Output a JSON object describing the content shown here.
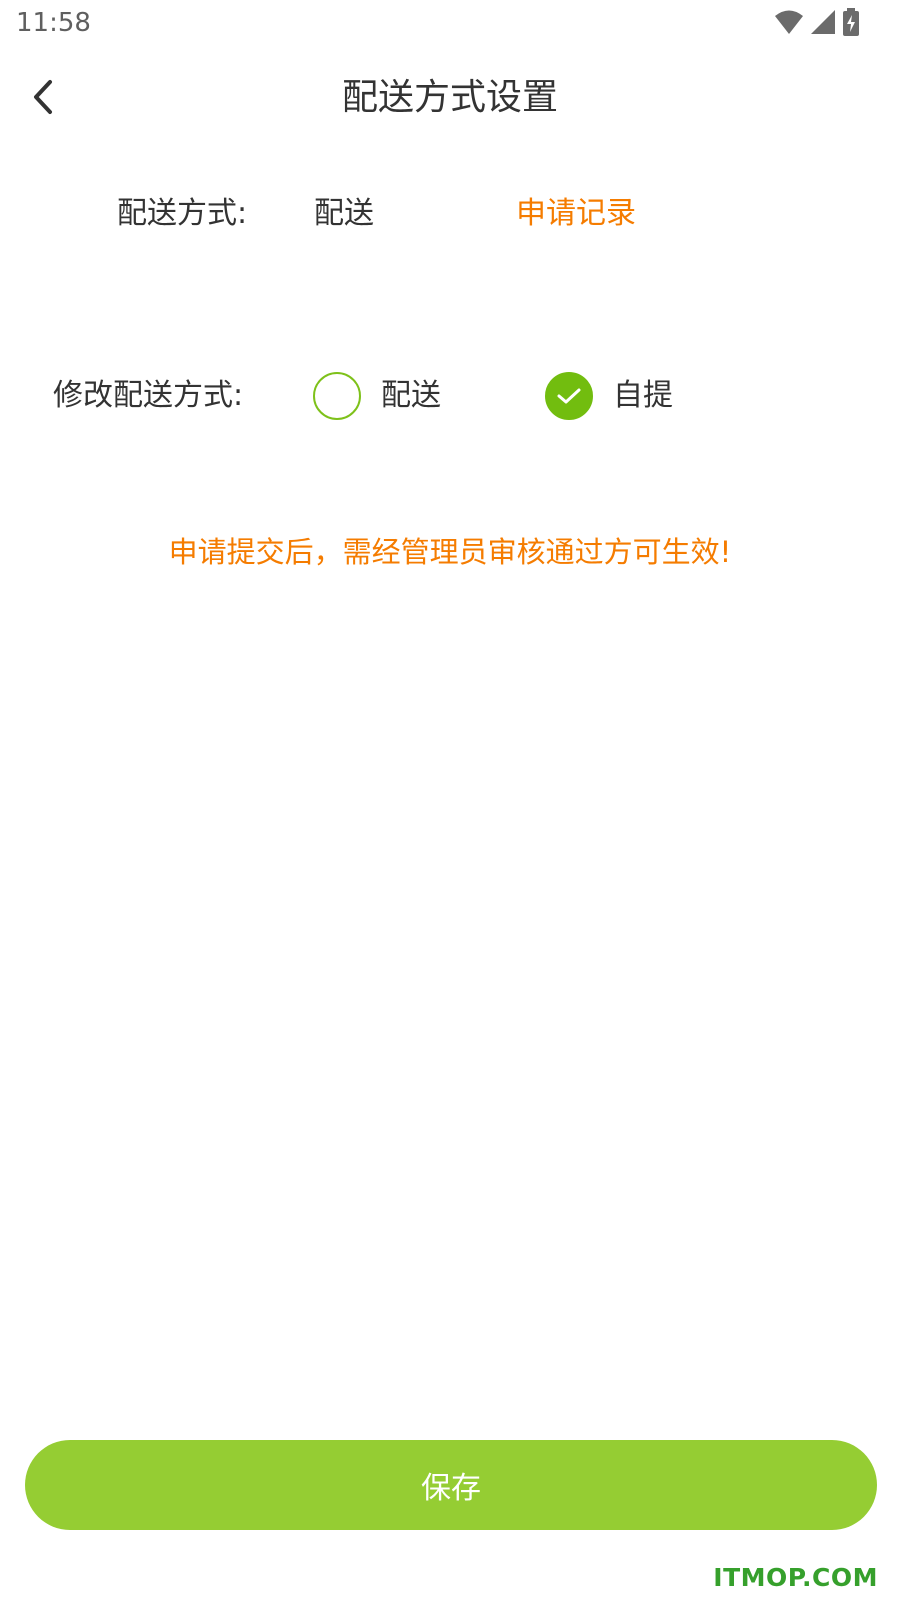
{
  "status_bar": {
    "time": "11:58",
    "icons": [
      "wifi-icon",
      "signal-icon",
      "battery-charging-icon"
    ]
  },
  "header": {
    "back_icon": "chevron-left-icon",
    "title": "配送方式设置"
  },
  "current": {
    "label": "配送方式:",
    "value": "配送",
    "record_link": "申请记录"
  },
  "modify": {
    "label": "修改配送方式:",
    "options": [
      {
        "label": "配送",
        "checked": false
      },
      {
        "label": "自提",
        "checked": true
      }
    ]
  },
  "notice": "申请提交后，需经管理员审核通过方可生效!",
  "save_label": "保存",
  "watermark": "ITMOP.COM",
  "colors": {
    "accent_green": "#95cd33",
    "check_green": "#72bd0f",
    "orange": "#f57c00",
    "text": "#333333"
  }
}
